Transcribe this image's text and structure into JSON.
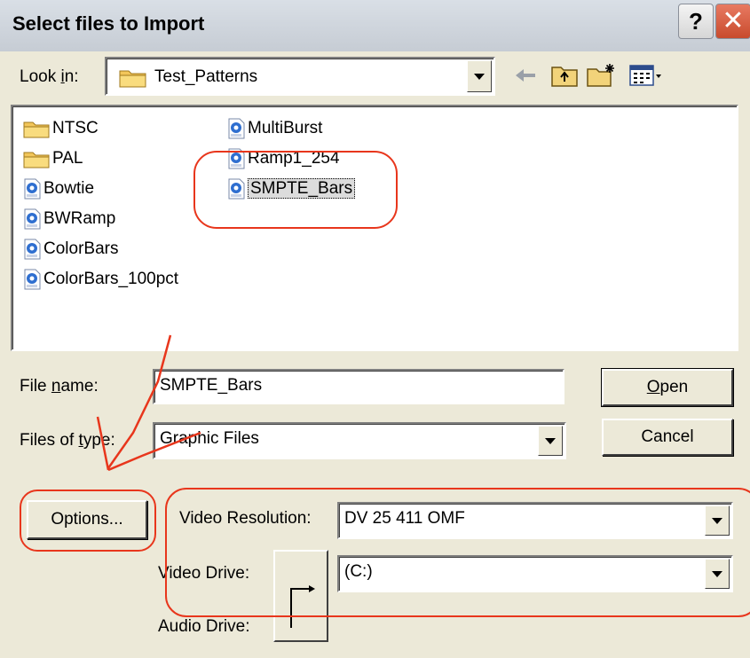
{
  "window": {
    "title": "Select files to Import",
    "help_symbol": "?",
    "close_symbol": "✕"
  },
  "look_in": {
    "label_pre": "Look ",
    "label_accel": "i",
    "label_post": "n:",
    "value": "Test_Patterns"
  },
  "files": {
    "column1": [
      {
        "name": "NTSC",
        "icon": "folder-icon"
      },
      {
        "name": "PAL",
        "icon": "folder-icon"
      },
      {
        "name": "Bowtie",
        "icon": "graphic-file-icon"
      },
      {
        "name": "BWRamp",
        "icon": "graphic-file-icon"
      },
      {
        "name": "ColorBars",
        "icon": "graphic-file-icon"
      },
      {
        "name": "ColorBars_100pct",
        "icon": "graphic-file-icon"
      }
    ],
    "column2": [
      {
        "name": "MultiBurst",
        "icon": "graphic-file-icon"
      },
      {
        "name": "Ramp1_254",
        "icon": "graphic-file-icon"
      },
      {
        "name": "SMPTE_Bars",
        "icon": "graphic-file-icon",
        "selected": true
      }
    ]
  },
  "file_name": {
    "label_pre": "File ",
    "label_accel": "n",
    "label_post": "ame:",
    "value": "SMPTE_Bars"
  },
  "file_type": {
    "label_pre": "Files of ",
    "label_accel": "t",
    "label_post": "ype:",
    "value": "Graphic Files"
  },
  "buttons": {
    "open_accel": "O",
    "open_rest": "pen",
    "cancel": "Cancel",
    "options": "Options..."
  },
  "video_resolution": {
    "label": "Video Resolution:",
    "value": "DV 25 411  OMF"
  },
  "video_drive": {
    "label": "Video Drive:",
    "value": "(C:)"
  },
  "audio_drive": {
    "label": "Audio Drive:"
  },
  "annotation_color": "#e8361c"
}
